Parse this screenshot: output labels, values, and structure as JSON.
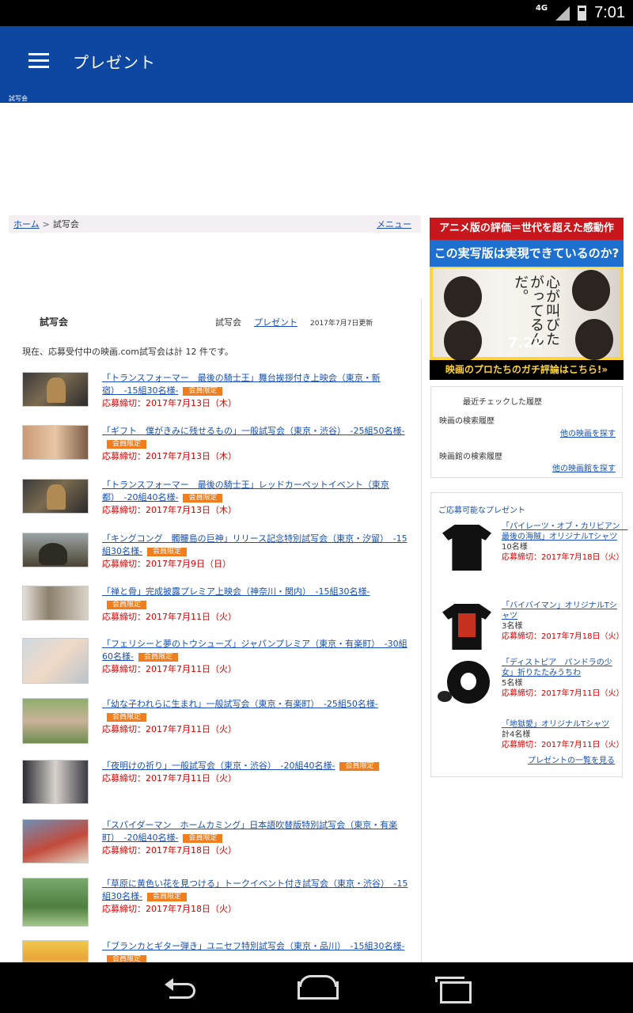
{
  "status_bar": {
    "network": "4G",
    "time": "7:01"
  },
  "app_bar": {
    "title": "プレゼント",
    "subtitle": "試写会"
  },
  "breadcrumb": {
    "home": "ホーム",
    "separator": ">",
    "current": "試写会",
    "menu": "メニュー"
  },
  "section": {
    "heading": "試写会",
    "tab_screening": "試写会",
    "tab_present": "プレゼント",
    "updated": "2017年7月7日更新",
    "intro": "現在、応募受付中の映画.com試写会は計 12 件です。"
  },
  "badge_label": "会員限定",
  "events": [
    {
      "title": "「トランスフォーマー　最後の騎士王」舞台挨拶付き上映会（東京・新宿）　-15組30名様-",
      "deadline": "応募締切：2017年7月13日（木）"
    },
    {
      "title": "「ギフト　僕がきみに残せるもの」一般試写会（東京・渋谷）　-25組50名様-",
      "deadline": "応募締切：2017年7月13日（木）"
    },
    {
      "title": "「トランスフォーマー　最後の騎士王」レッドカーペットイベント（東京都）　-20組40名様-",
      "deadline": "応募締切：2017年7月13日（木）"
    },
    {
      "title": "「キングコング　髑髏島の巨神」リリース記念特別試写会（東京・汐留）　-15組30名様-",
      "deadline": "応募締切：2017年7月9日（日）"
    },
    {
      "title": "「禅と骨」完成披露プレミア上映会（神奈川・関内）　-15組30名様-",
      "deadline": "応募締切：2017年7月11日（火）"
    },
    {
      "title": "「フェリシーと夢のトウシューズ」ジャパンプレミア（東京・有楽町）　-30組60名様-",
      "deadline": "応募締切：2017年7月11日（火）"
    },
    {
      "title": "「幼な子われらに生まれ」一般試写会（東京・有楽町）　-25組50名様-",
      "deadline": "応募締切：2017年7月11日（火）"
    },
    {
      "title": "「夜明けの祈り」一般試写会（東京・渋谷）　-20組40名様-",
      "deadline": "応募締切：2017年7月11日（火）"
    },
    {
      "title": "「スパイダーマン　ホームカミング」日本語吹替版特別試写会（東京・有楽町）　-20組40名様-",
      "deadline": "応募締切：2017年7月18日（火）"
    },
    {
      "title": "「草原に黄色い花を見つける」トークイベント付き試写会（東京・渋谷）　-15組30名様-",
      "deadline": "応募締切：2017年7月18日（火）"
    },
    {
      "title": "「ブランカとギター弾き」ユニセフ特別試写会（東京・品川）　-15組30名様-",
      "deadline": ""
    }
  ],
  "ad": {
    "top_line": "アニメ版の評価＝世代を超えた感動作",
    "mid_line": "この実写版は実現できているのか?",
    "copy": "心が叫びたがってるんだ。",
    "date": "7.22",
    "bottom_line": "映画のプロたちのガチ評論はこちら!»"
  },
  "history": {
    "title": "最近チェックした履歴",
    "movie_label": "映画の検索履歴",
    "movie_link": "他の映画を探す",
    "theater_label": "映画館の検索履歴",
    "theater_link": "他の映画館を探す"
  },
  "presents": {
    "heading": "ご応募可能なプレゼント",
    "items": [
      {
        "title": "「パイレーツ・オブ・カリビアン　最後の海賊」オリジナルTシャツ",
        "qty": "10名様",
        "deadline": "応募締切：2017年7月18日（火）"
      },
      {
        "title": "「バイバイマン」オリジナルTシャツ",
        "qty": "3名様",
        "deadline": "応募締切：2017年7月18日（火）"
      },
      {
        "title": "「ディストピア　パンドラの少女」折りたたみうちわ",
        "qty": "5名様",
        "deadline": "応募締切：2017年7月11日（火）"
      },
      {
        "title": "「地獄愛」オリジナルTシャツ",
        "qty": "計4名様",
        "deadline": "応募締切：2017年7月11日（火）"
      }
    ],
    "more": "プレゼントの一覧を見る"
  }
}
